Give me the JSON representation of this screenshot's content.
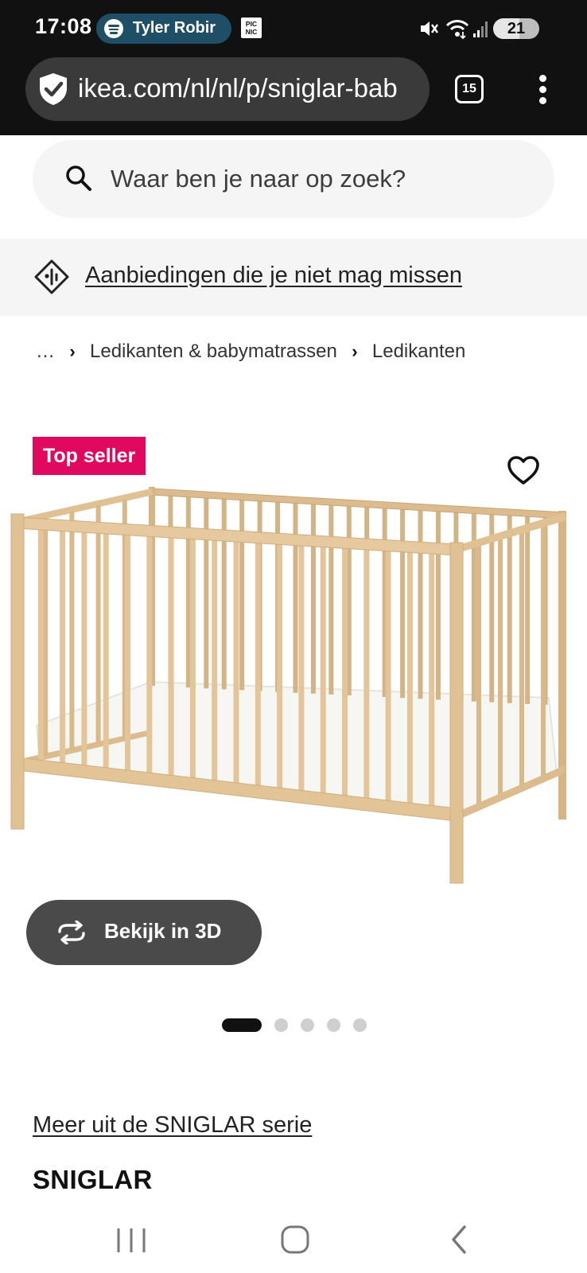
{
  "status_bar": {
    "time": "17:08",
    "media_title": "Tyler Robir",
    "picnic_label": "PIC NIC",
    "battery": "21",
    "battery_level": 0.21
  },
  "browser": {
    "url": "ikea.com/nl/nl/p/sniglar-bab",
    "tab_count": "15"
  },
  "search": {
    "placeholder": "Waar ben je naar op zoek?"
  },
  "promo": {
    "label": "Aanbiedingen die je niet mag missen"
  },
  "breadcrumb": {
    "ellipsis": "…",
    "items": [
      "Ledikanten & babymatrassen",
      "Ledikanten"
    ]
  },
  "product": {
    "badge": "Top seller",
    "view_3d_label": "Bekijk in 3D",
    "image_count": 5,
    "active_image": 1,
    "series_link": "Meer uit de SNIGLAR serie",
    "title": "SNIGLAR"
  },
  "colors": {
    "badge": "#e0085f",
    "chrome": "#111111",
    "button_3d": "#4a4a4a"
  }
}
